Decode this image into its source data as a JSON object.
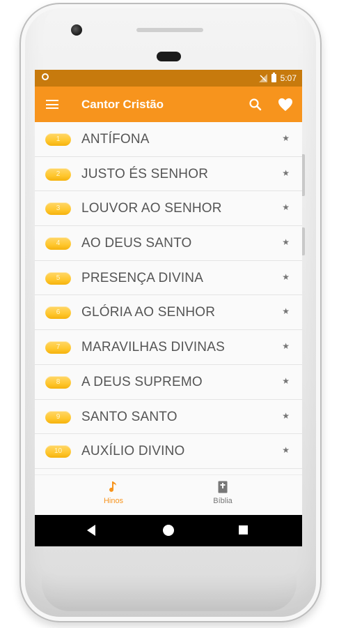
{
  "statusbar": {
    "time": "5:07"
  },
  "appbar": {
    "title": "Cantor Cristão",
    "menu_icon": "menu-icon",
    "search_icon": "search-icon",
    "favorites_icon": "heart-icon"
  },
  "hymns": [
    {
      "number": "1",
      "title": "ANTÍFONA"
    },
    {
      "number": "2",
      "title": "JUSTO ÉS SENHOR"
    },
    {
      "number": "3",
      "title": "LOUVOR AO SENHOR"
    },
    {
      "number": "4",
      "title": "AO DEUS SANTO"
    },
    {
      "number": "5",
      "title": "PRESENÇA DIVINA"
    },
    {
      "number": "6",
      "title": "GLÓRIA AO SENHOR"
    },
    {
      "number": "7",
      "title": "MARAVILHAS DIVINAS"
    },
    {
      "number": "8",
      "title": "A DEUS SUPREMO"
    },
    {
      "number": "9",
      "title": "SANTO SANTO"
    },
    {
      "number": "10",
      "title": "AUXÍLIO DIVINO"
    }
  ],
  "bottom_nav": {
    "items": [
      {
        "label": "Hinos",
        "icon": "music-note-icon",
        "selected": true
      },
      {
        "label": "Bíblia",
        "icon": "bible-icon",
        "selected": false
      }
    ]
  },
  "colors": {
    "primary": "#f7941d",
    "statusbar": "#c77a0d",
    "badge": "#ffc72e"
  }
}
